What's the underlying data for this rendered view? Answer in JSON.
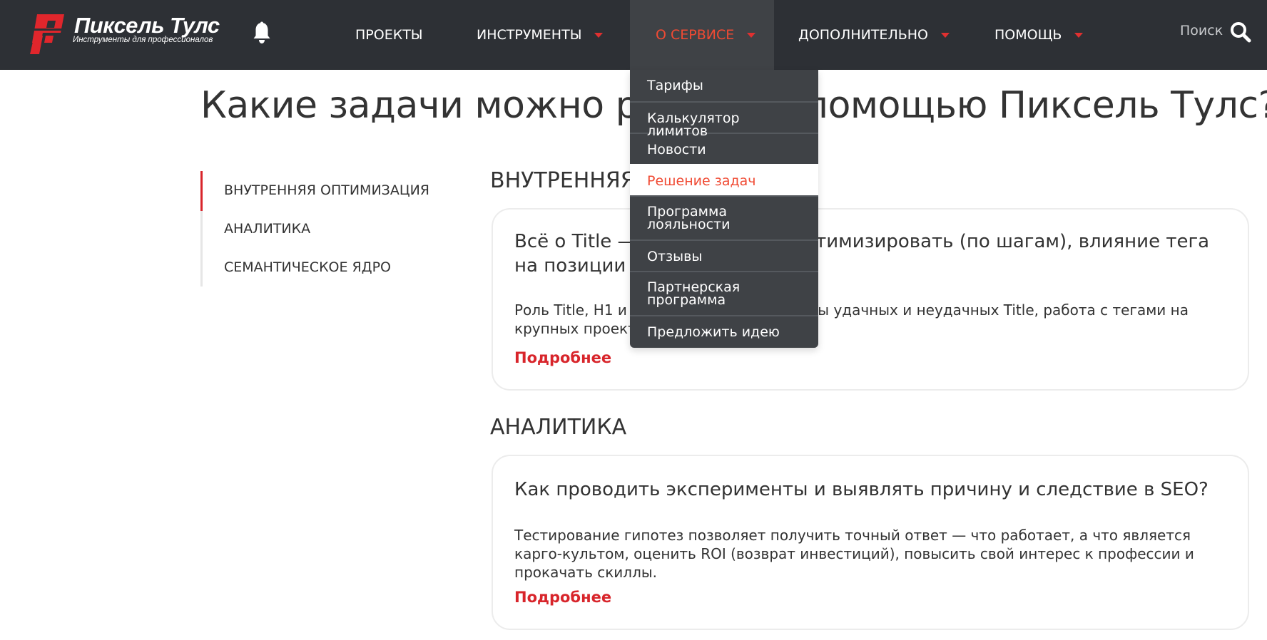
{
  "header": {
    "logo": {
      "title": "Пиксель Тулс",
      "subtitle": "Инструменты для профессионалов",
      "mark_color": "#e0262c"
    },
    "nav": [
      {
        "label": "ПРОЕКТЫ",
        "has_caret": false
      },
      {
        "label": "ИНСТРУМЕНТЫ",
        "has_caret": true
      },
      {
        "label": "О СЕРВИСЕ",
        "has_caret": true,
        "active": true
      },
      {
        "label": "ДОПОЛНИТЕЛЬНО",
        "has_caret": true
      },
      {
        "label": "ПОМОЩЬ",
        "has_caret": true
      }
    ],
    "search_label": "Поиск",
    "icons": {
      "notifications": "bell-icon",
      "search": "search-icon",
      "caret": "caret-down-icon"
    }
  },
  "dropdown": {
    "items": [
      {
        "label": "Тарифы"
      },
      {
        "label": "Калькулятор лимитов"
      },
      {
        "label": "Новости"
      },
      {
        "label": "Решение задач",
        "active": true
      },
      {
        "label": "Программа лояльности"
      },
      {
        "label": "Отзывы"
      },
      {
        "label": "Партнерская программа"
      },
      {
        "label": "Предложить идею"
      }
    ]
  },
  "page": {
    "title": "Какие задачи можно решить с помощью Пиксель Тулс?",
    "toc": [
      {
        "label": "ВНУТРЕННЯЯ ОПТИМИЗАЦИЯ",
        "active": true
      },
      {
        "label": "АНАЛИТИКА"
      },
      {
        "label": "СЕМАНТИЧЕСКОЕ ЯДРО"
      }
    ],
    "sections": [
      {
        "heading": "ВНУТРЕННЯЯ ОПТИМИЗАЦИЯ",
        "card": {
          "title": "Всё о Title — как правильно оптимизировать (по шагам), влияние тега на позиции и ранжирование",
          "text": "Роль Title, H1 и meta description, примеры удачных и неудачных Title, работа с тегами на крупных проектах.",
          "link": "Подробнее"
        }
      },
      {
        "heading": "АНАЛИТИКА",
        "card": {
          "title": "Как проводить эксперименты и выявлять причину и следствие в SEO?",
          "text": "Тестирование гипотез позволяет получить точный ответ — что работает, а что является карго-культом, оценить ROI (возврат инвестиций), повысить свой интерес к профессии и прокачать скиллы.",
          "link": "Подробнее"
        }
      }
    ]
  },
  "colors": {
    "header_bg": "#2d3035",
    "active_nav_bg": "#3f4246",
    "accent_orange": "#f04a33",
    "accent_red": "#d8252b",
    "text": "#333333"
  }
}
